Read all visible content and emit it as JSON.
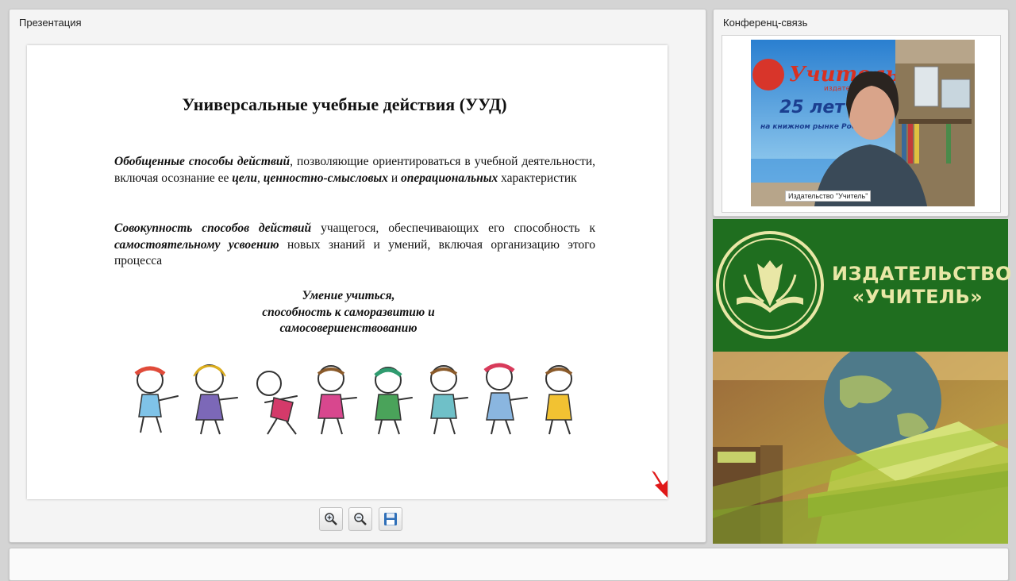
{
  "presentation": {
    "title": "Презентация",
    "slide": {
      "heading": "Универсальные учебные действия (УУД)",
      "p1": {
        "t1": "Обобщенные способы действий",
        "t2": ", позволяющие ориентироваться в учебной деятельности, включая осознание ее ",
        "t3": "цели",
        "t4": ", ",
        "t5": "ценностно-смысловых",
        "t6": " и ",
        "t7": "операциональных",
        "t8": " характеристик"
      },
      "p2": {
        "t1": "Совокупность способов действий",
        "t2": " учащегося, обеспечивающих его способность к ",
        "t3": "самостоятельному усвоению",
        "t4": " новых знаний и умений, включая организацию этого процесса"
      },
      "center": {
        "line1": "Умение учиться,",
        "line2": "способность к саморазвитию и",
        "line3": "самосовершенствованию"
      }
    },
    "toolbar": {
      "zoom_in_icon": "zoom-in-icon",
      "zoom_out_icon": "zoom-out-icon",
      "save_icon": "floppy-disk-icon"
    }
  },
  "conference": {
    "title": "Конференц-связь",
    "participant_name": "Издательство \"Учитель\"",
    "banner": {
      "brand": "Учитель",
      "sub": "издательство",
      "years": "25 лет",
      "tag": "на книжном рынке России"
    }
  },
  "logo": {
    "line1": "ИЗДАТЕЛЬСТВО",
    "line2": "«УЧИТЕЛЬ»",
    "bg_color": "#1f6e1f",
    "text_color": "#e9e7a6"
  }
}
